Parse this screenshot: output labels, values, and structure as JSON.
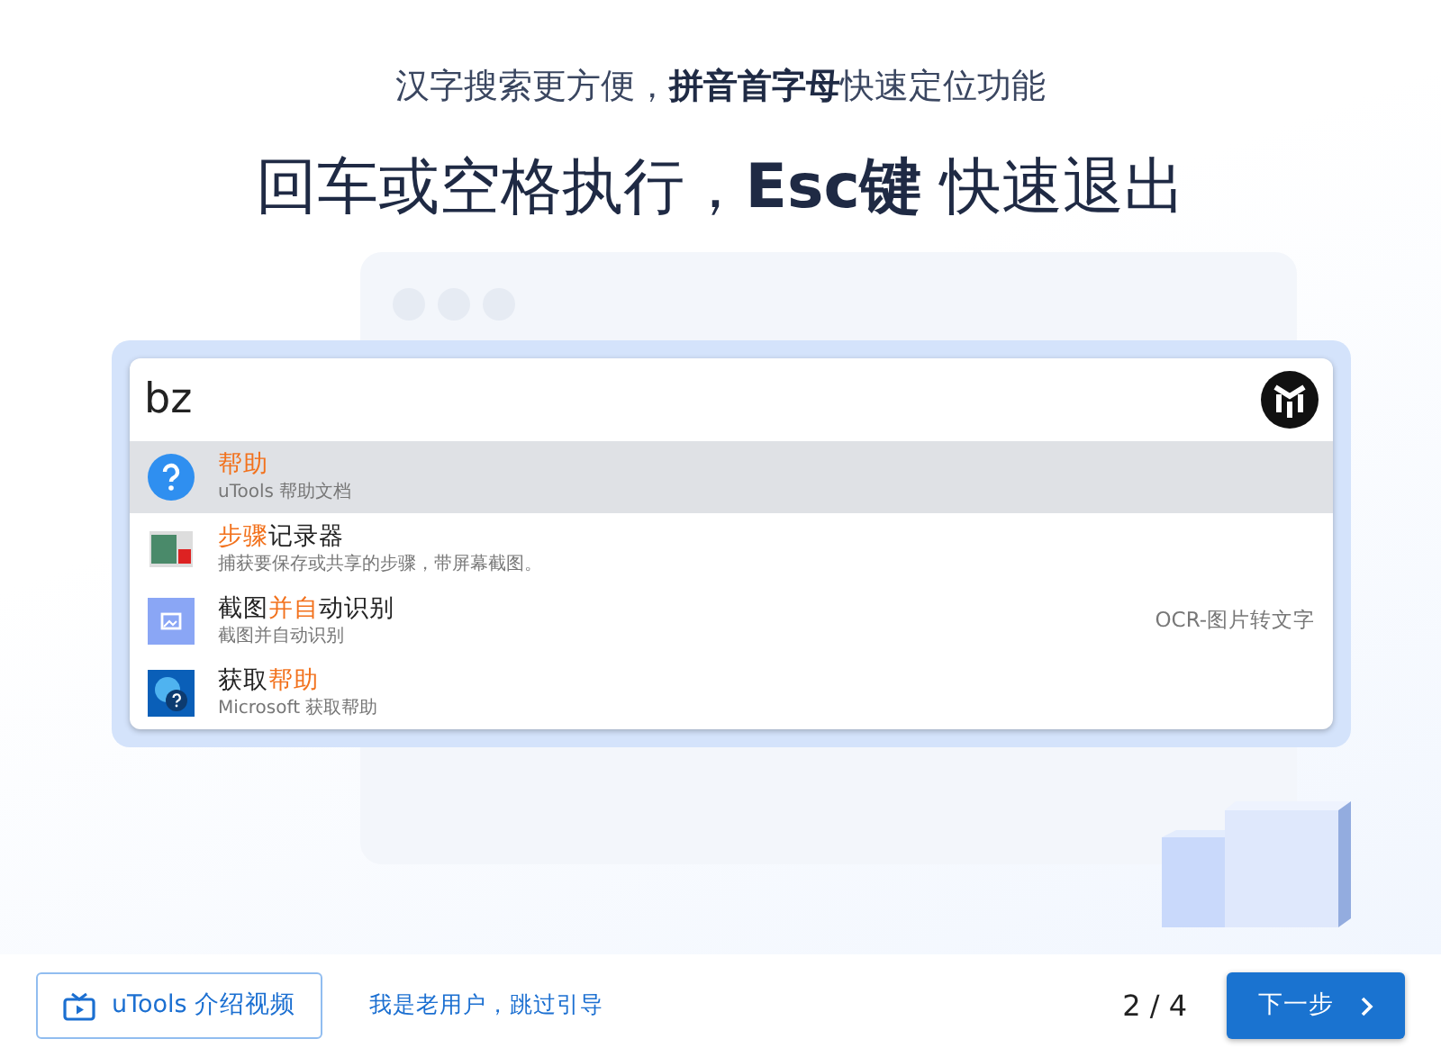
{
  "subtitle": "汉字搜索更方便，**拼音首字母**快速定位功能",
  "headline": "回车或空格执行，**Esc键** 快速退出",
  "search": {
    "value": "bz"
  },
  "results": [
    {
      "kind": "help",
      "title": [
        {
          "text": "帮助",
          "match": true
        }
      ],
      "description": "uTools 帮助文档",
      "selected": true
    },
    {
      "kind": "recorder",
      "title": [
        {
          "text": "步骤",
          "match": true
        },
        {
          "text": "记录器",
          "match": false
        }
      ],
      "description": "捕获要保存或共享的步骤，带屏幕截图。",
      "selected": false
    },
    {
      "kind": "ocr",
      "title": [
        {
          "text": "截图",
          "match": false
        },
        {
          "text": "并自",
          "match": true
        },
        {
          "text": "动识别",
          "match": false
        }
      ],
      "description": "截图并自动识别",
      "tag": "OCR-图片转文字",
      "selected": false
    },
    {
      "kind": "gethelp",
      "title": [
        {
          "text": "获取",
          "match": false
        },
        {
          "text": "帮助",
          "match": true
        }
      ],
      "description": "Microsoft 获取帮助",
      "selected": false
    }
  ],
  "footer": {
    "video_button": "uTools 介绍视频",
    "skip_link": "我是老用户，跳过引导",
    "page_indicator": "2 / 4",
    "next_button": "下一步"
  }
}
